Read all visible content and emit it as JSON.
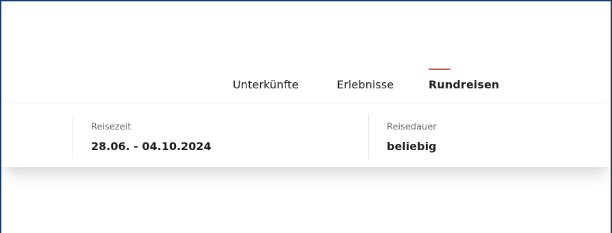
{
  "nav": {
    "tabs": [
      {
        "label": "Unterkünfte",
        "active": false
      },
      {
        "label": "Erlebnisse",
        "active": false
      },
      {
        "label": "Rundreisen",
        "active": true
      }
    ],
    "active_indicator_color": "#e84a3c"
  },
  "search": {
    "travel_period": {
      "label": "Reisezeit",
      "value": "28.06. - 04.10.2024"
    },
    "travel_duration": {
      "label": "Reisedauer",
      "value": "beliebig"
    }
  }
}
